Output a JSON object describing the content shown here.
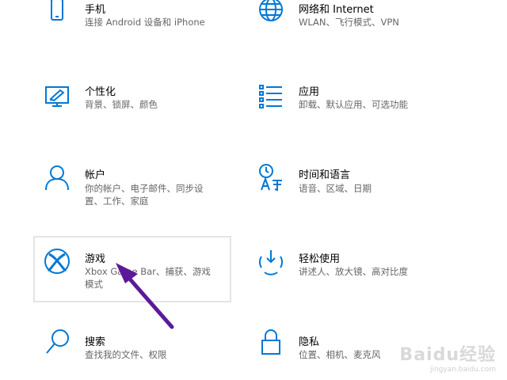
{
  "items": [
    {
      "title": "手机",
      "desc": "连接 Android 设备和 iPhone",
      "icon": "phone-icon"
    },
    {
      "title": "网络和 Internet",
      "desc": "WLAN、飞行模式、VPN",
      "icon": "globe-icon"
    },
    {
      "title": "个性化",
      "desc": "背景、锁屏、颜色",
      "icon": "personalization-icon"
    },
    {
      "title": "应用",
      "desc": "卸载、默认应用、可选功能",
      "icon": "apps-list-icon"
    },
    {
      "title": "帐户",
      "desc": "你的帐户、电子邮件、同步设置、工作、家庭",
      "icon": "person-icon"
    },
    {
      "title": "时间和语言",
      "desc": "语音、区域、日期",
      "icon": "time-language-icon"
    },
    {
      "title": "游戏",
      "desc": "Xbox Game Bar、捕获、游戏模式",
      "icon": "xbox-icon"
    },
    {
      "title": "轻松使用",
      "desc": "讲述人、放大镜、高对比度",
      "icon": "ease-of-access-icon"
    },
    {
      "title": "搜索",
      "desc": "查找我的文件、权限",
      "icon": "search-icon"
    },
    {
      "title": "隐私",
      "desc": "位置、相机、麦克风",
      "icon": "lock-icon"
    }
  ],
  "colors": {
    "accent": "#0078d7",
    "arrow": "#5b1a99"
  },
  "watermark": {
    "logo": "Baidu经验",
    "url": "jingyan.baidu.com"
  }
}
